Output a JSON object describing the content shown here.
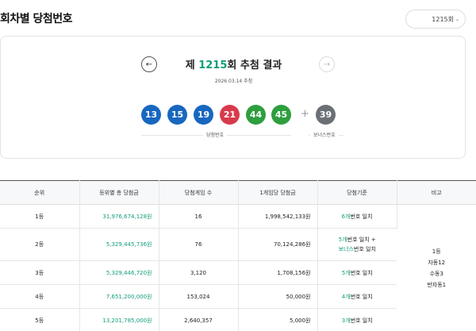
{
  "page": {
    "title": "회차별 당첨번호"
  },
  "round_select": {
    "value": "1215회",
    "chevron": "⌄"
  },
  "draw": {
    "prefix": "제 ",
    "round": "1215",
    "suffix": "회 추첨 결과",
    "date": "2026.03.14 추첨",
    "prev_label": "←",
    "next_label": "→",
    "numbers": [
      "13",
      "15",
      "19",
      "21",
      "44",
      "45"
    ],
    "number_colors": [
      "#1867bf",
      "#1867bf",
      "#1867bf",
      "#d83a4b",
      "#2e9e3f",
      "#2e9e3f"
    ],
    "plus": "+",
    "bonus": "39",
    "bonus_color": "#6b6f76",
    "numbers_label": "당첨번호",
    "bonus_label": "보너스번호"
  },
  "table": {
    "headers": [
      "순위",
      "등위별 총 당첨금",
      "당첨게임 수",
      "1게임당 당첨금",
      "당첨기준",
      "비고"
    ],
    "rows": [
      {
        "rank": "1등",
        "total": "31,976,674,128원",
        "games": "16",
        "per_game": "1,998,542,133원",
        "crit_green": "6개",
        "crit_rest": "번호 일치"
      },
      {
        "rank": "2등",
        "total": "5,329,445,736원",
        "games": "76",
        "per_game": "70,124,286원",
        "crit_green": "5개",
        "crit_rest": "번호 일치 +",
        "crit_green2": "보너스",
        "crit_rest2": "번호 일치"
      },
      {
        "rank": "3등",
        "total": "5,329,446,720원",
        "games": "3,120",
        "per_game": "1,708,156원",
        "crit_green": "5개",
        "crit_rest": "번호 일치"
      },
      {
        "rank": "4등",
        "total": "7,651,200,000원",
        "games": "153,024",
        "per_game": "50,000원",
        "crit_green": "4개",
        "crit_rest": "번호 일치"
      },
      {
        "rank": "5등",
        "total": "13,201,785,000원",
        "games": "2,640,357",
        "per_game": "5,000원",
        "crit_green": "3개",
        "crit_rest": "번호 일치"
      }
    ],
    "note": {
      "line1": "1등",
      "line2": "자동12",
      "line3": "수동3",
      "line4": "반자동1"
    }
  }
}
